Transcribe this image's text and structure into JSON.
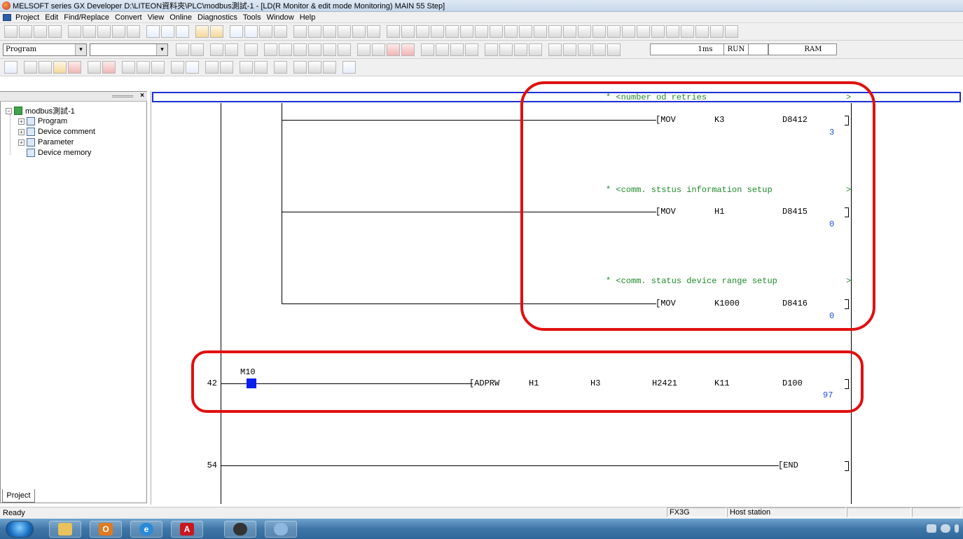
{
  "window": {
    "title": "MELSOFT series GX Developer D:\\LITEON資料夾\\PLC\\modbus測試-1 - [LD(R Monitor & edit mode Monitoring)    MAIN    55 Step]"
  },
  "menu": [
    "Project",
    "Edit",
    "Find/Replace",
    "Convert",
    "View",
    "Online",
    "Diagnostics",
    "Tools",
    "Window",
    "Help"
  ],
  "toolbar2": {
    "data_type": "Program",
    "second_select": "",
    "scan_time": "1ms",
    "run_status": "RUN",
    "memory": "RAM"
  },
  "project_tree": {
    "root": "modbus測試-1",
    "items": [
      "Program",
      "Device comment",
      "Parameter",
      "Device memory"
    ],
    "tab": "Project"
  },
  "ladder": {
    "comments": [
      "* <number od retries",
      "* <comm. ststus information setup",
      "* <comm. status device range setup"
    ],
    "comment_tail": ">",
    "instructions": [
      {
        "op": "[MOV",
        "arg1": "K3",
        "arg2": "D8412",
        "value": "3"
      },
      {
        "op": "[MOV",
        "arg1": "H1",
        "arg2": "D8415",
        "value": "0"
      },
      {
        "op": "[MOV",
        "arg1": "K1000",
        "arg2": "D8416",
        "value": "0"
      }
    ],
    "rung42": {
      "step": "42",
      "contact": "M10",
      "op": "[ADPRW",
      "args": [
        "H1",
        "H3",
        "H2421",
        "K11",
        "D100"
      ],
      "value": "97"
    },
    "rung54": {
      "step": "54",
      "op": "[END"
    }
  },
  "statusbar": {
    "ready": "Ready",
    "plc": "FX3G",
    "station": "Host station"
  },
  "colors": {
    "highlight": "#e01010",
    "comment": "#1f8a2a",
    "value": "#1b4fd8",
    "cursor": "#1d2fd6"
  }
}
